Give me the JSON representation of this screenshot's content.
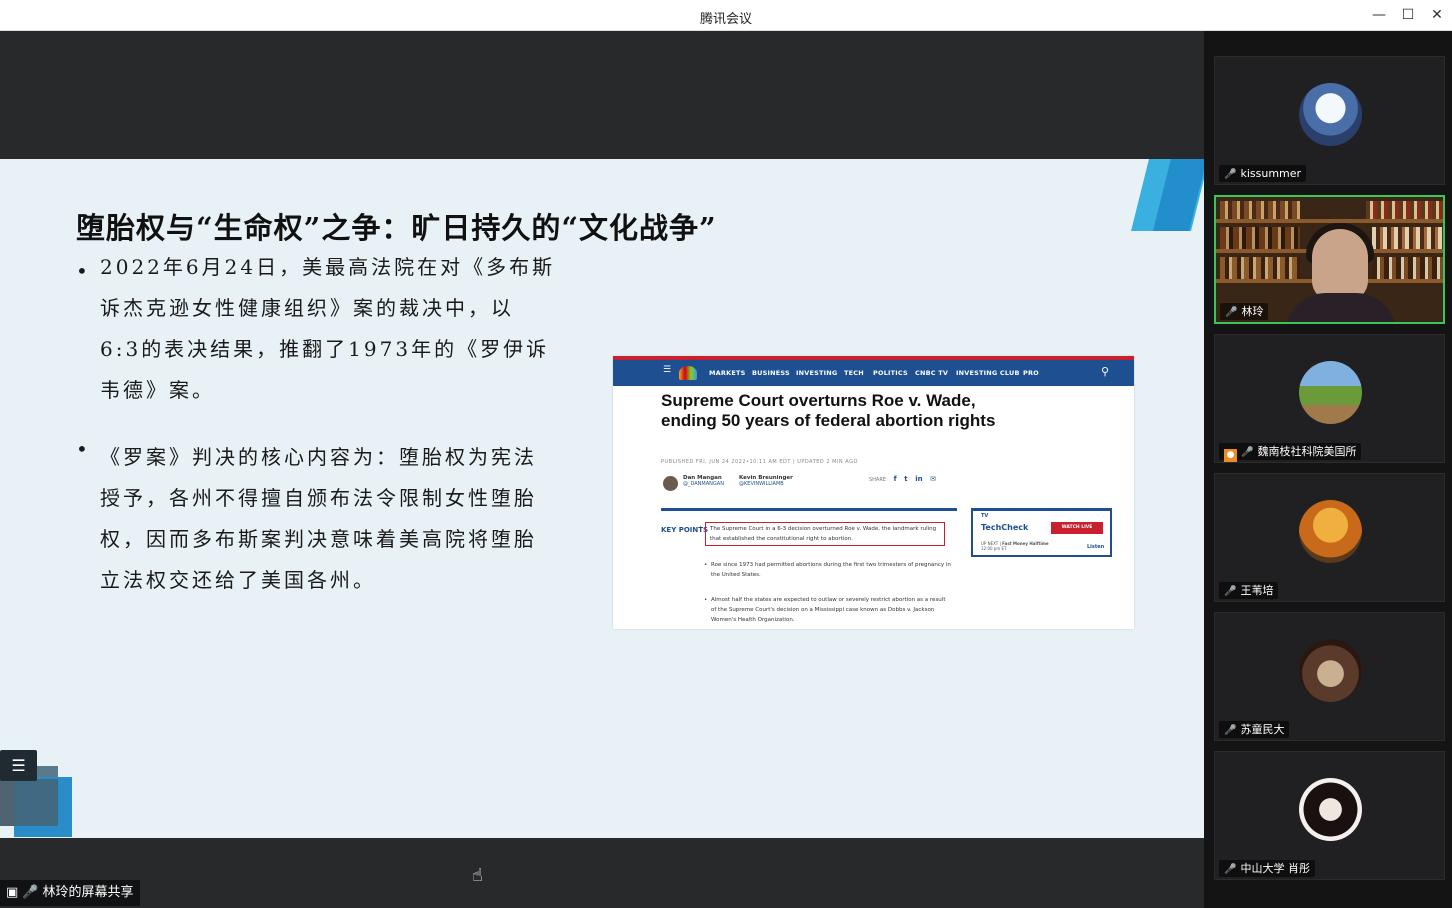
{
  "window": {
    "title": "腾讯会议",
    "minimize_icon": "minimize-icon",
    "maximize_icon": "maximize-icon",
    "close_icon": "close-icon"
  },
  "slide": {
    "title": "堕胎权与“生命权”之争：旷日持久的“文化战争”",
    "bullets": [
      {
        "lines": [
          "2022年6月24日，美最高法院在对《多布斯",
          "诉杰克逊女性健康组织》案的裁决中，以",
          "6:3的表决结果，推翻了1973年的《罗伊诉",
          "韦德》案。"
        ]
      },
      {
        "lines": [
          "《罗案》判决的核心内容为：堕胎权为宪法",
          "授予，各州不得擅自颁布法令限制女性堕胎",
          "权，因而多布斯案判决意味着美高院将堕胎",
          "立法权交还给了美国各州。"
        ]
      }
    ],
    "toc_icon": "list-icon"
  },
  "article": {
    "nav": [
      "MARKETS",
      "BUSINESS",
      "INVESTING",
      "TECH",
      "POLITICS",
      "CNBC TV",
      "INVESTING CLUB",
      "PRO"
    ],
    "headline": "Supreme Court overturns Roe v. Wade, ending 50 years of federal abortion rights",
    "meta": "PUBLISHED FRI, JUN 24 2022•10:11 AM EDT | UPDATED 2 MIN AGO",
    "author1_name": "Dan Mangan",
    "author1_handle": "@_DANMANGAN",
    "author2_name": "Kevin Breuninger",
    "author2_handle": "@KEVINWILLIAMB",
    "share_label": "SHARE",
    "key_points_label": "KEY POINTS",
    "key_points": [
      "The Supreme Court in a 6-3 decision overturned Roe v. Wade, the landmark ruling that established the constitutional right to abortion.",
      "Roe since 1973 had permitted abortions during the first two trimesters of pregnancy in the United States.",
      "Almost half the states are expected to outlaw or severely restrict abortion as a result of the Supreme Court's decision on a Mississippi case known as Dobbs v. Jackson Women's Health Organization."
    ],
    "tv_label": "TV",
    "tv_show": "TechCheck",
    "tv_watch": "WATCH LIVE",
    "tv_next_label": "UP NEXT",
    "tv_next_show": "Fast Money Halftime",
    "tv_next_time": "12:00 pm ET",
    "tv_listen": "Listen"
  },
  "share_status": {
    "label": "林玲的屏幕共享"
  },
  "participants": [
    {
      "name": "kissummer",
      "muted": true
    },
    {
      "name": "林玲",
      "muted": false,
      "speaking": true
    },
    {
      "name": "魏南枝社科院美国所",
      "muted": true
    },
    {
      "name": "王苇培",
      "muted": true
    },
    {
      "name": "苏童民大",
      "muted": true
    },
    {
      "name": "中山大学 肖彤",
      "muted": true
    }
  ],
  "colors": {
    "speaking_border": "#3cc35a",
    "cnbc_blue": "#1d4f91",
    "cnbc_red": "#c8202f"
  }
}
